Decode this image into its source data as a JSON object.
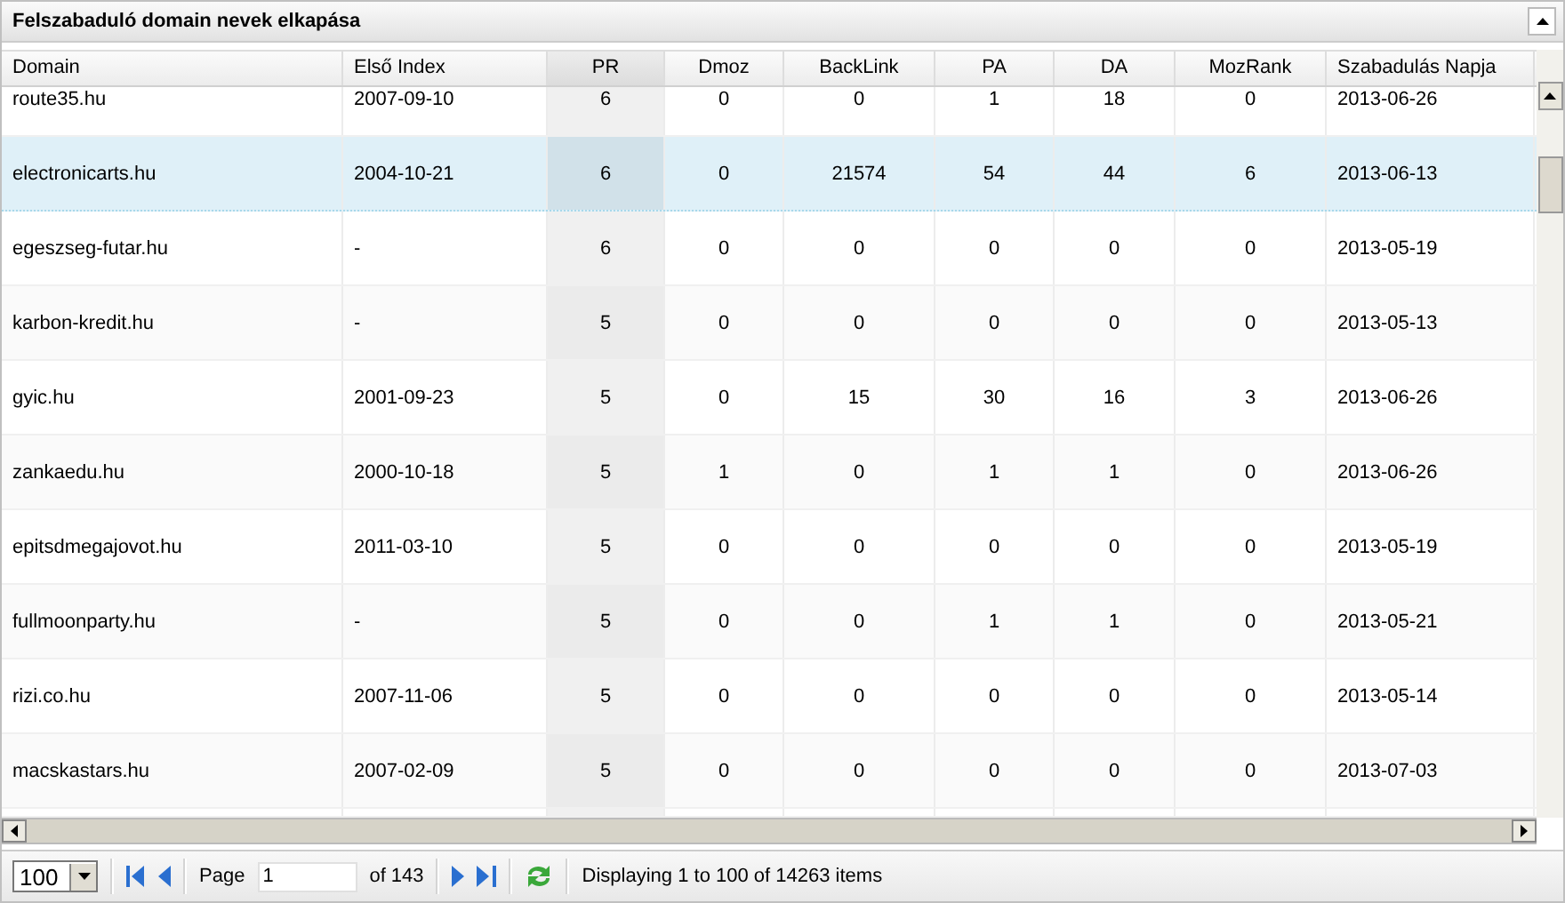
{
  "panel": {
    "title": "Felszabaduló domain nevek elkapása"
  },
  "table": {
    "columns": [
      {
        "label": "Domain",
        "kind": "text",
        "sorted": false
      },
      {
        "label": "Első Index",
        "kind": "date",
        "sorted": false
      },
      {
        "label": "PR",
        "kind": "number",
        "sorted": true
      },
      {
        "label": "Dmoz",
        "kind": "number",
        "sorted": false
      },
      {
        "label": "BackLink",
        "kind": "number",
        "sorted": false
      },
      {
        "label": "PA",
        "kind": "number",
        "sorted": false
      },
      {
        "label": "DA",
        "kind": "number",
        "sorted": false
      },
      {
        "label": "MozRank",
        "kind": "number",
        "sorted": false
      },
      {
        "label": "Szabadulás Napja",
        "kind": "date",
        "sorted": false
      }
    ],
    "rows": [
      {
        "selected": false,
        "cells": [
          "route35.hu",
          "2007-09-10",
          "6",
          "0",
          "0",
          "1",
          "18",
          "0",
          "2013-06-26"
        ]
      },
      {
        "selected": true,
        "cells": [
          "electronicarts.hu",
          "2004-10-21",
          "6",
          "0",
          "21574",
          "54",
          "44",
          "6",
          "2013-06-13"
        ]
      },
      {
        "selected": false,
        "cells": [
          "egeszseg-futar.hu",
          "-",
          "6",
          "0",
          "0",
          "0",
          "0",
          "0",
          "2013-05-19"
        ]
      },
      {
        "selected": false,
        "cells": [
          "karbon-kredit.hu",
          "-",
          "5",
          "0",
          "0",
          "0",
          "0",
          "0",
          "2013-05-13"
        ]
      },
      {
        "selected": false,
        "cells": [
          "gyic.hu",
          "2001-09-23",
          "5",
          "0",
          "15",
          "30",
          "16",
          "3",
          "2013-06-26"
        ]
      },
      {
        "selected": false,
        "cells": [
          "zankaedu.hu",
          "2000-10-18",
          "5",
          "1",
          "0",
          "1",
          "1",
          "0",
          "2013-06-26"
        ]
      },
      {
        "selected": false,
        "cells": [
          "epitsdmegajovot.hu",
          "2011-03-10",
          "5",
          "0",
          "0",
          "0",
          "0",
          "0",
          "2013-05-19"
        ]
      },
      {
        "selected": false,
        "cells": [
          "fullmoonparty.hu",
          "-",
          "5",
          "0",
          "0",
          "1",
          "1",
          "0",
          "2013-05-21"
        ]
      },
      {
        "selected": false,
        "cells": [
          "rizi.co.hu",
          "2007-11-06",
          "5",
          "0",
          "0",
          "0",
          "0",
          "0",
          "2013-05-14"
        ]
      },
      {
        "selected": false,
        "cells": [
          "macskastars.hu",
          "2007-02-09",
          "5",
          "0",
          "0",
          "0",
          "0",
          "0",
          "2013-07-03"
        ]
      }
    ]
  },
  "pager": {
    "page_size": "100",
    "page_label": "Page",
    "page": "1",
    "of_label": "of 143",
    "status": "Displaying 1 to 100 of 14263 items"
  }
}
